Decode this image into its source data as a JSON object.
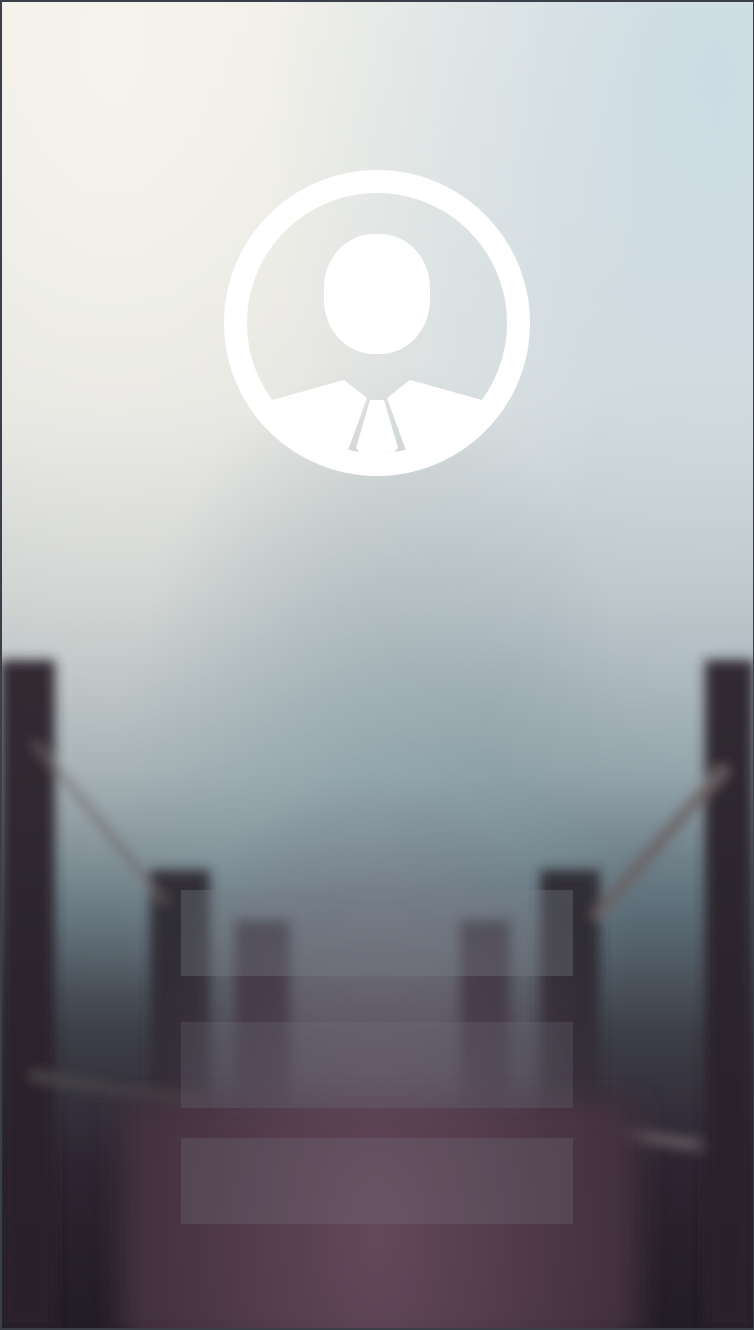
{
  "login": {
    "username_value": "",
    "username_placeholder": "",
    "password_value": "",
    "password_placeholder": "",
    "submit_label": ""
  },
  "icons": {
    "avatar": "user-business-avatar-icon"
  },
  "colors": {
    "sky_light": "#f0eeea",
    "sky_blue": "#c9d7df",
    "sea": "#6f8a95",
    "deck_dark": "#1f1a21",
    "deck_plum": "#5c4254",
    "avatar_white": "#ffffff"
  }
}
